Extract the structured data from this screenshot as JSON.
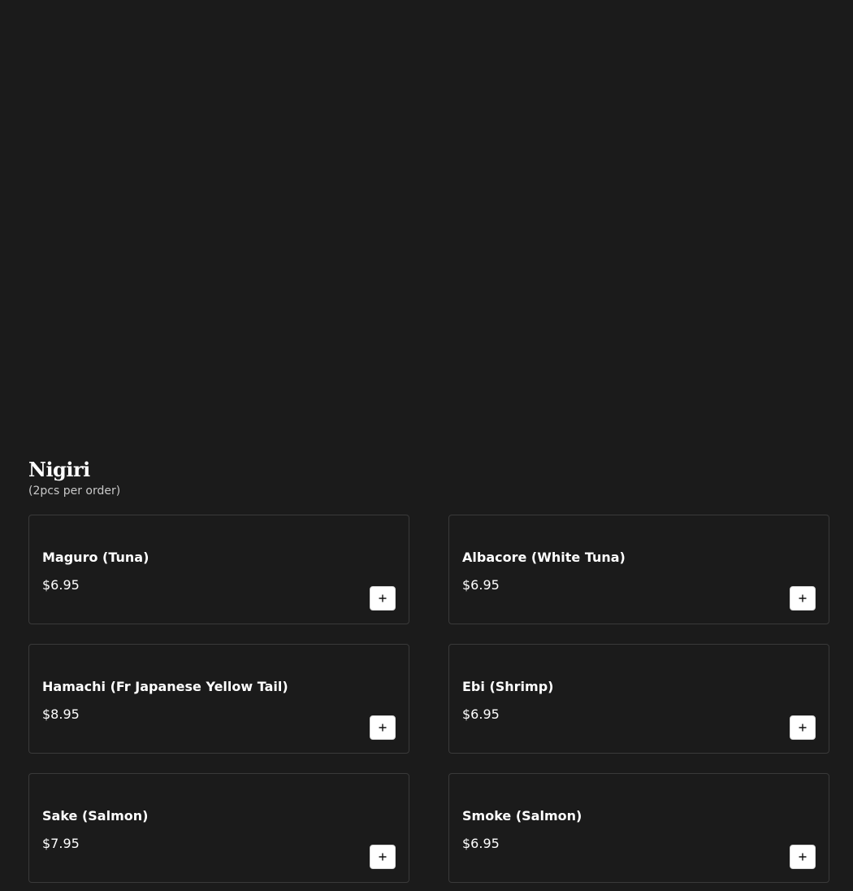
{
  "section": {
    "title": "Nigiri",
    "subtitle": "(2pcs per order)"
  },
  "items": [
    {
      "name": "Maguro (Tuna)",
      "price": "$6.95"
    },
    {
      "name": "Albacore (White Tuna)",
      "price": "$6.95"
    },
    {
      "name": "Hamachi (Fr Japanese Yellow Tail)",
      "price": "$8.95"
    },
    {
      "name": "Ebi (Shrimp)",
      "price": "$6.95"
    },
    {
      "name": "Sake (Salmon)",
      "price": "$7.95"
    },
    {
      "name": "Smoke (Salmon)",
      "price": "$6.95"
    }
  ],
  "icons": {
    "add": "plus-icon"
  },
  "colors": {
    "background": "#1b1b1b",
    "card_border": "#3a3a3a",
    "text": "#ffffff",
    "button_bg": "#ffffff"
  }
}
